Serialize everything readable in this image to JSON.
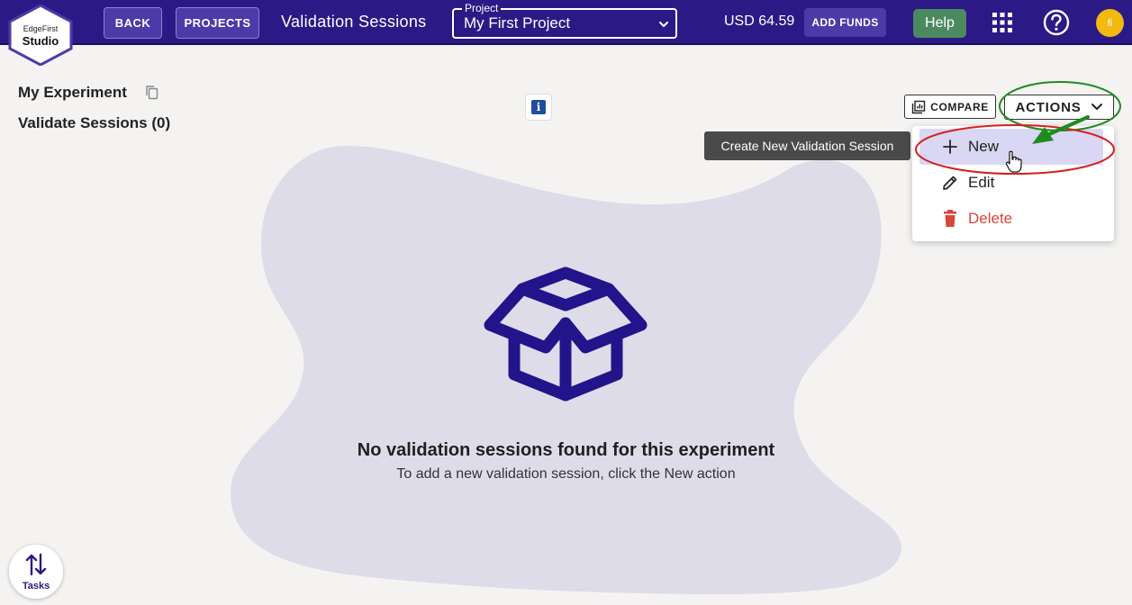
{
  "brand": {
    "line1": "EdgeFirst",
    "line2": "Studio"
  },
  "topbar": {
    "back_label": "BACK",
    "projects_label": "PROJECTS",
    "page_title": "Validation Sessions",
    "project_legend": "Project",
    "project_value": "My First Project",
    "balance": "USD 64.59",
    "add_funds_label": "ADD FUNDS",
    "help_label": "Help",
    "avatar_initial": "fi"
  },
  "header": {
    "experiment_name": "My Experiment",
    "sessions_title": "Validate Sessions (0)",
    "info_glyph": "i"
  },
  "empty_state": {
    "title": "No validation sessions found for this experiment",
    "subtitle": "To add a new validation session, click the New action"
  },
  "actions": {
    "compare_label": "COMPARE",
    "actions_label": "ACTIONS",
    "tooltip": "Create New Validation Session",
    "menu": [
      {
        "label": "New",
        "icon": "plus-icon"
      },
      {
        "label": "Edit",
        "icon": "pencil-icon"
      },
      {
        "label": "Delete",
        "icon": "trash-icon"
      }
    ]
  },
  "tasks": {
    "label": "Tasks"
  },
  "colors": {
    "topbar": "#2b1a85",
    "button": "#4d3aa8",
    "help": "#4b8a5e",
    "avatar": "#f2b90e",
    "blob": "#dfdce9",
    "box_icon": "#22148a",
    "delete": "#d8443a",
    "annotation_red": "#d62020",
    "annotation_green": "#1f8a1f"
  }
}
